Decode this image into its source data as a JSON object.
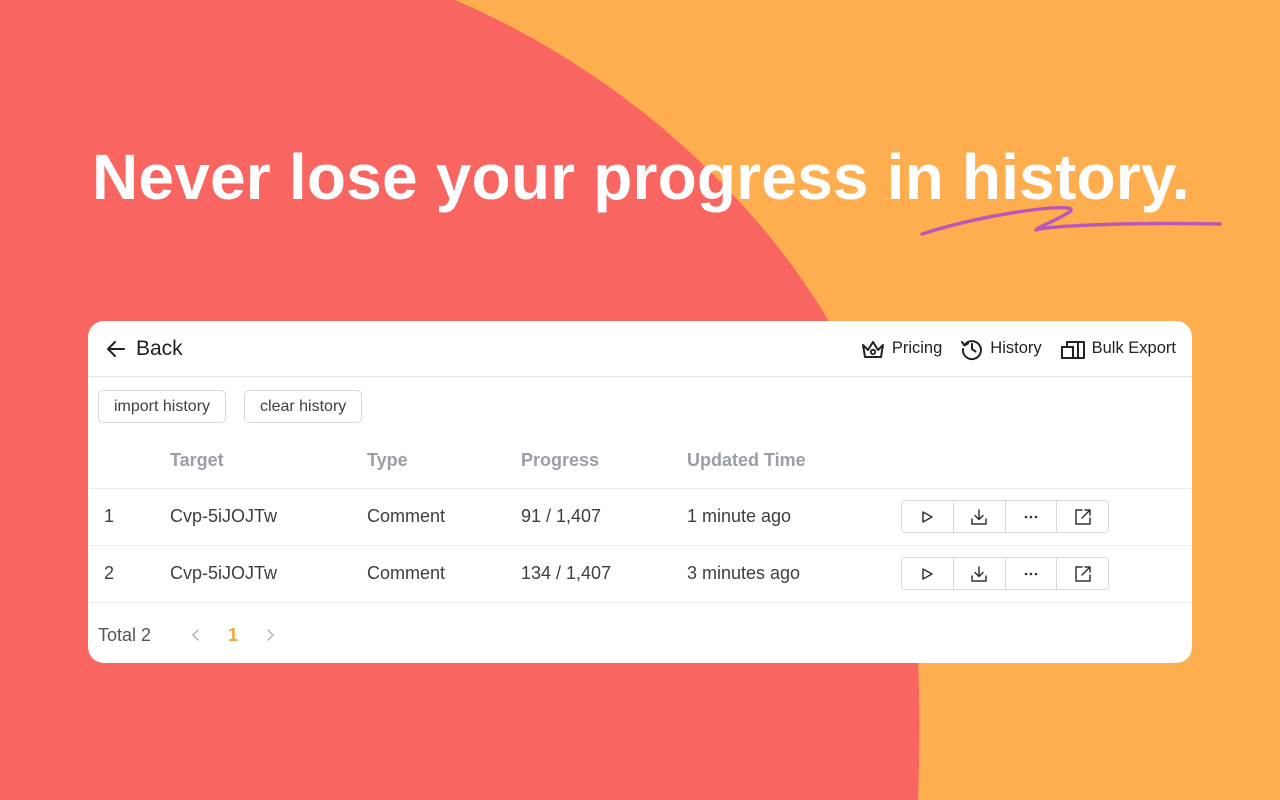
{
  "colors": {
    "background_orange": "#FFAE4F",
    "blob_coral": "#F96561",
    "squiggle_purple": "#B85AB5",
    "page_accent": "#F2A53C"
  },
  "headline": "Never lose your progress in history.",
  "topbar": {
    "back_label": "Back",
    "nav": [
      {
        "label": "Pricing",
        "icon": "crown-icon"
      },
      {
        "label": "History",
        "icon": "history-icon"
      },
      {
        "label": "Bulk Export",
        "icon": "bulk-export-icon"
      }
    ]
  },
  "toolbar": {
    "import_label": "import history",
    "clear_label": "clear history"
  },
  "table": {
    "columns": [
      "",
      "Target",
      "Type",
      "Progress",
      "Updated Time",
      ""
    ],
    "rows": [
      {
        "index": "1",
        "target": "Cvp-5iJOJTw",
        "type": "Comment",
        "progress": "91 / 1,407",
        "updated": "1 minute ago"
      },
      {
        "index": "2",
        "target": "Cvp-5iJOJTw",
        "type": "Comment",
        "progress": "134 / 1,407",
        "updated": "3 minutes ago"
      }
    ],
    "row_actions": [
      "play-icon",
      "download-icon",
      "more-icon",
      "open-external-icon"
    ]
  },
  "pagination": {
    "total_label": "Total 2",
    "current_page": "1"
  }
}
